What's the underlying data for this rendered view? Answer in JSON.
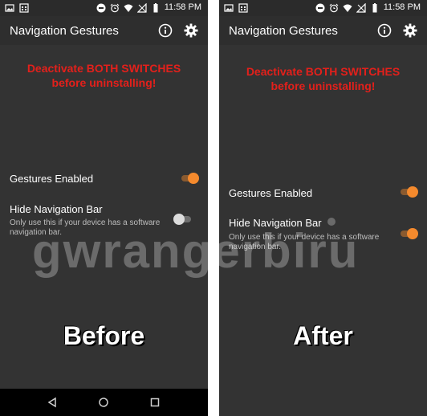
{
  "before": {
    "status": {
      "time": "11:58 PM"
    },
    "app_title": "Navigation Gestures",
    "warning_line1": "Deactivate BOTH SWITCHES",
    "warning_line2": "before uninstalling!",
    "gestures_label": "Gestures Enabled",
    "gestures_on": true,
    "hide_nav_label": "Hide Navigation Bar",
    "hide_nav_desc": "Only use this if your device has a software navigation bar.",
    "hide_nav_on": false,
    "caption": "Before"
  },
  "after": {
    "status": {
      "time": "11:58 PM"
    },
    "app_title": "Navigation Gestures",
    "warning_line1": "Deactivate BOTH SWITCHES",
    "warning_line2": "before uninstalling!",
    "gestures_label": "Gestures Enabled",
    "gestures_on": true,
    "hide_nav_label": "Hide Navigation Bar",
    "hide_nav_desc": "Only use this if your device has a software navigation bar.",
    "hide_nav_on": true,
    "caption": "After"
  },
  "watermark": "gwrangerbiru",
  "colors": {
    "accent": "#f58a2d",
    "warning": "#e3201b",
    "background": "#333333"
  },
  "icons": {
    "info": "info-icon",
    "settings": "gear-icon",
    "nav_back": "back-triangle-icon",
    "nav_home": "home-circle-icon",
    "nav_recents": "recents-square-icon"
  }
}
